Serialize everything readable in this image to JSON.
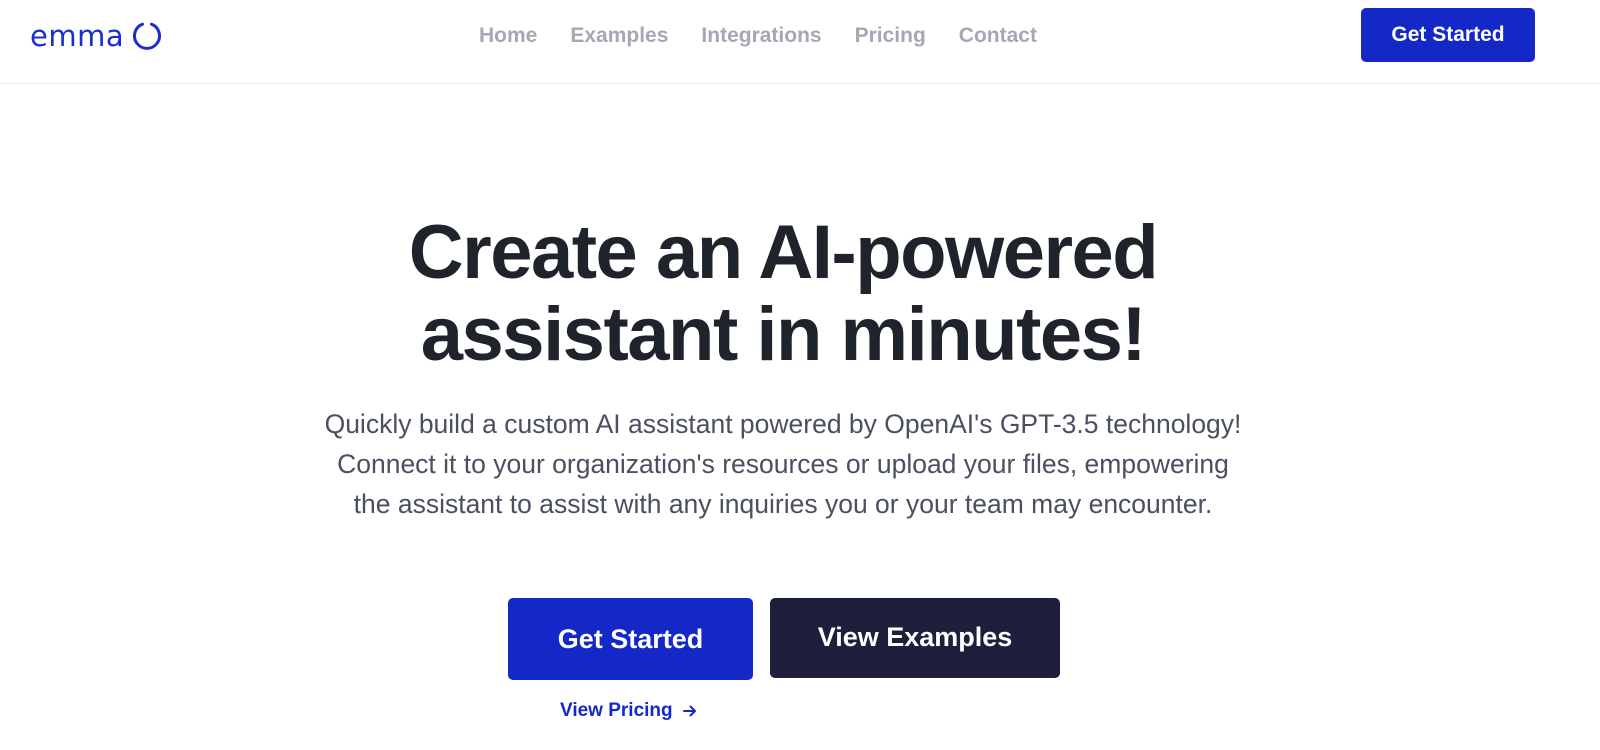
{
  "header": {
    "logo_text": "emma",
    "nav": [
      "Home",
      "Examples",
      "Integrations",
      "Pricing",
      "Contact"
    ],
    "cta_label": "Get Started"
  },
  "hero": {
    "title_line1": "Create an AI-powered",
    "title_line2": "assistant in minutes!",
    "subtitle_line1": "Quickly build a custom AI assistant powered by OpenAI's GPT-3.5 technology!",
    "subtitle_line2": "Connect it to your organization's resources or upload your files, empowering",
    "subtitle_line3": "the assistant to assist with any inquiries you or your team may encounter.",
    "primary_button": "Get Started",
    "secondary_button": "View Examples",
    "pricing_link": "View Pricing",
    "pricing_link_icon": "arrow-right-icon"
  },
  "colors": {
    "brand_blue": "#1428c8",
    "dark_navy": "#1d1f3d",
    "nav_gray": "#a3a8b2",
    "heading": "#1f232b",
    "body_text": "#4b5060"
  },
  "icons": {
    "logo_mark": "circle-ring-icon"
  }
}
